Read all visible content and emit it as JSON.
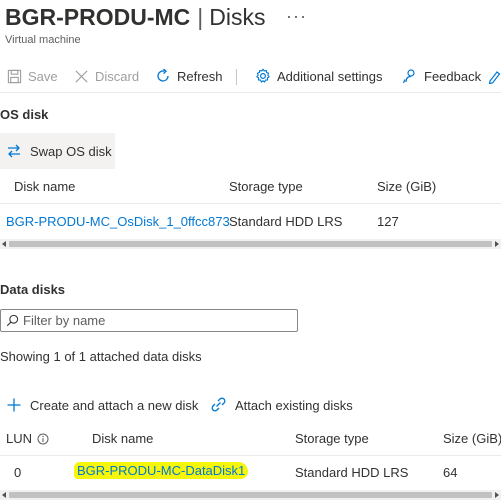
{
  "header": {
    "resource_name": "BGR-PRODU-MC",
    "separator": "|",
    "page_name": "Disks",
    "more_label": "···",
    "subtitle": "Virtual machine"
  },
  "toolbar": {
    "save_label": "Save",
    "discard_label": "Discard",
    "refresh_label": "Refresh",
    "additional_settings_label": "Additional settings",
    "feedback_label": "Feedback"
  },
  "os_disk": {
    "heading": "OS disk",
    "swap_label": "Swap OS disk",
    "columns": [
      "Disk name",
      "Storage type",
      "Size (GiB)"
    ],
    "rows": [
      {
        "name": "BGR-PRODU-MC_OsDisk_1_0ffcc873",
        "storage_type": "Standard HDD LRS",
        "size": "127"
      }
    ]
  },
  "data_disks": {
    "heading": "Data disks",
    "filter_placeholder": "Filter by name",
    "count_text": "Showing 1 of 1 attached data disks",
    "create_label": "Create and attach a new disk",
    "attach_label": "Attach existing disks",
    "columns": [
      "LUN",
      "Disk name",
      "Storage type",
      "Size (GiB)"
    ],
    "rows": [
      {
        "lun": "0",
        "name": "BGR-PRODU-MC-DataDisk1",
        "storage_type": "Standard HDD LRS",
        "size": "64"
      }
    ]
  },
  "colors": {
    "link": "#0078d4",
    "highlight": "#f6f60a",
    "text": "#323130"
  },
  "icons": [
    "save-icon",
    "close-icon",
    "refresh-icon",
    "gear-icon",
    "feedback-icon",
    "swap-icon",
    "search-icon",
    "plus-icon",
    "attach-icon",
    "info-icon"
  ]
}
